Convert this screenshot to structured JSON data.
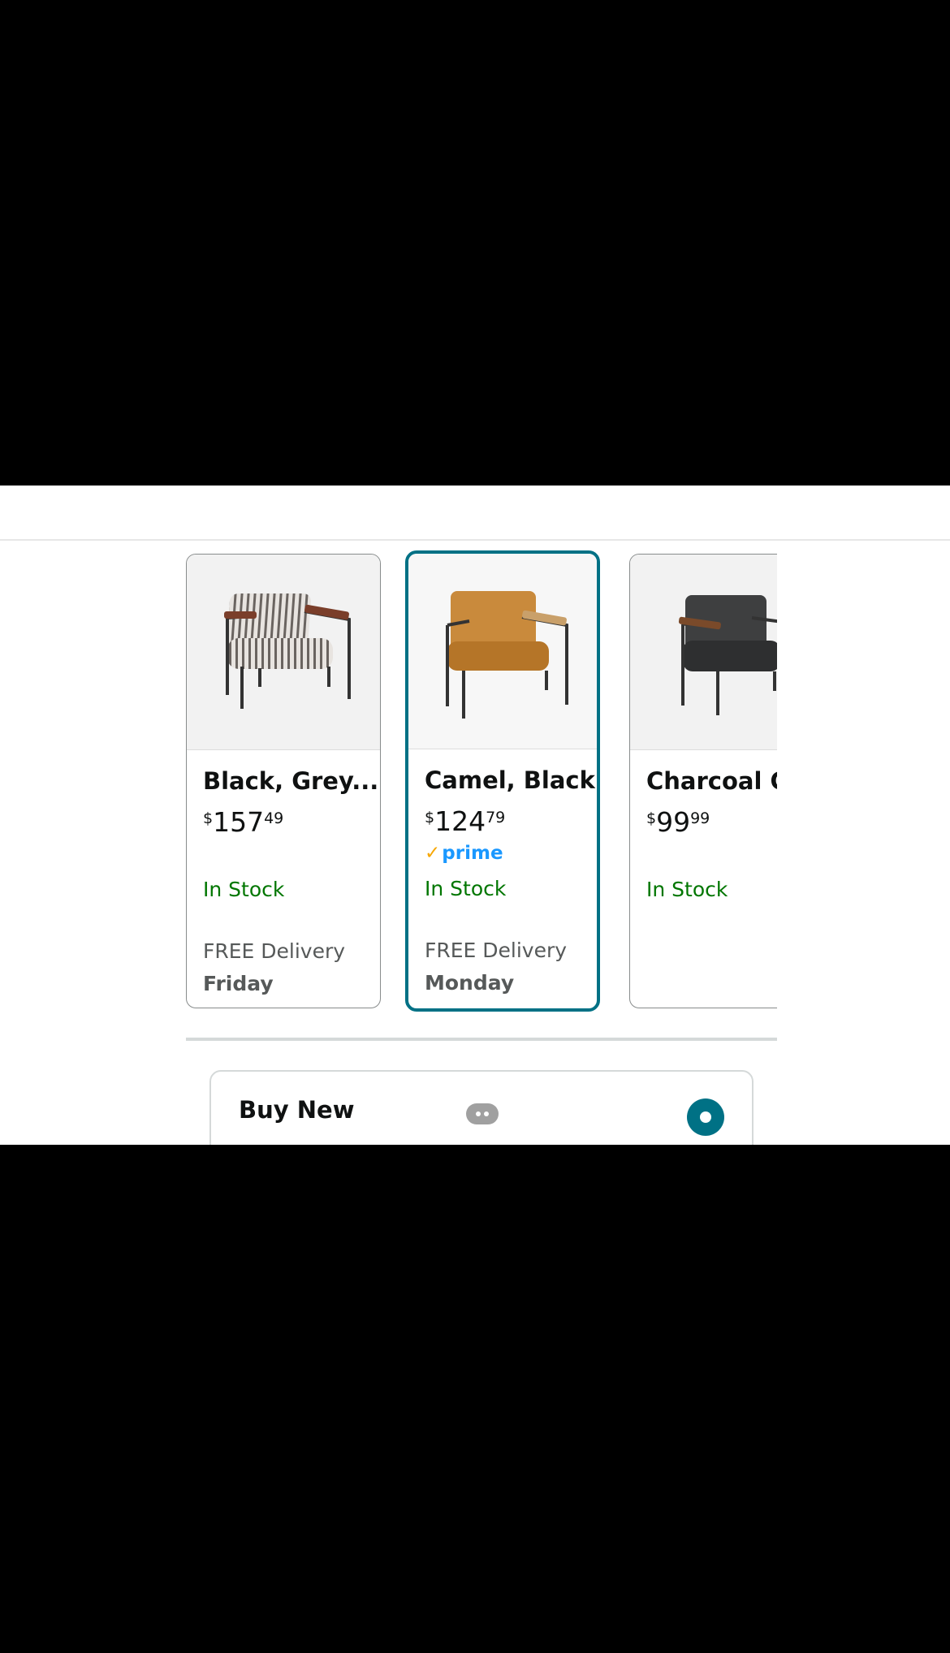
{
  "variants": [
    {
      "name": "Black, Grey...",
      "currency": "$",
      "price_whole": "157",
      "price_fraction": "49",
      "prime": "",
      "stock": "In Stock",
      "delivery_label": "FREE Delivery",
      "delivery_day": "Friday",
      "selected": false,
      "upholstery": "striped grey"
    },
    {
      "name": "Camel, Black",
      "currency": "$",
      "price_whole": "124",
      "price_fraction": "79",
      "prime": "prime",
      "stock": "In Stock",
      "delivery_label": "FREE Delivery",
      "delivery_day": "Monday",
      "selected": true,
      "upholstery": "camel leather"
    },
    {
      "name": "Charcoal Gr",
      "currency": "$",
      "price_whole": "99",
      "price_fraction": "99",
      "prime": "",
      "stock": "In Stock",
      "delivery_label": "",
      "delivery_day": "",
      "selected": false,
      "upholstery": "charcoal"
    }
  ],
  "buy_option": {
    "label": "Buy New",
    "icon": "more-options-icon",
    "selected": true
  },
  "colors": {
    "selected_border": "#007185",
    "in_stock": "#007600",
    "prime_blue": "#1a98ff",
    "prime_check": "#f7a700"
  }
}
